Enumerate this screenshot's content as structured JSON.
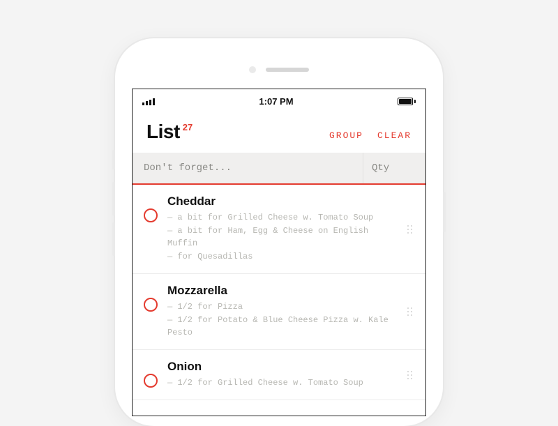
{
  "status": {
    "time": "1:07 PM"
  },
  "header": {
    "title": "List",
    "count": "27",
    "group_label": "GROUP",
    "clear_label": "CLEAR"
  },
  "input": {
    "placeholder": "Don't forget...",
    "qty_placeholder": "Qty"
  },
  "items": [
    {
      "name": "Cheddar",
      "notes": [
        "— a bit for Grilled Cheese w. Tomato Soup",
        "— a bit for Ham, Egg & Cheese on English Muffin",
        "— for Quesadillas"
      ]
    },
    {
      "name": "Mozzarella",
      "notes": [
        "— 1/2 for Pizza",
        "— 1/2 for Potato & Blue Cheese Pizza w. Kale Pesto"
      ]
    },
    {
      "name": "Onion",
      "notes": [
        "— 1/2 for Grilled Cheese w. Tomato Soup"
      ]
    }
  ]
}
